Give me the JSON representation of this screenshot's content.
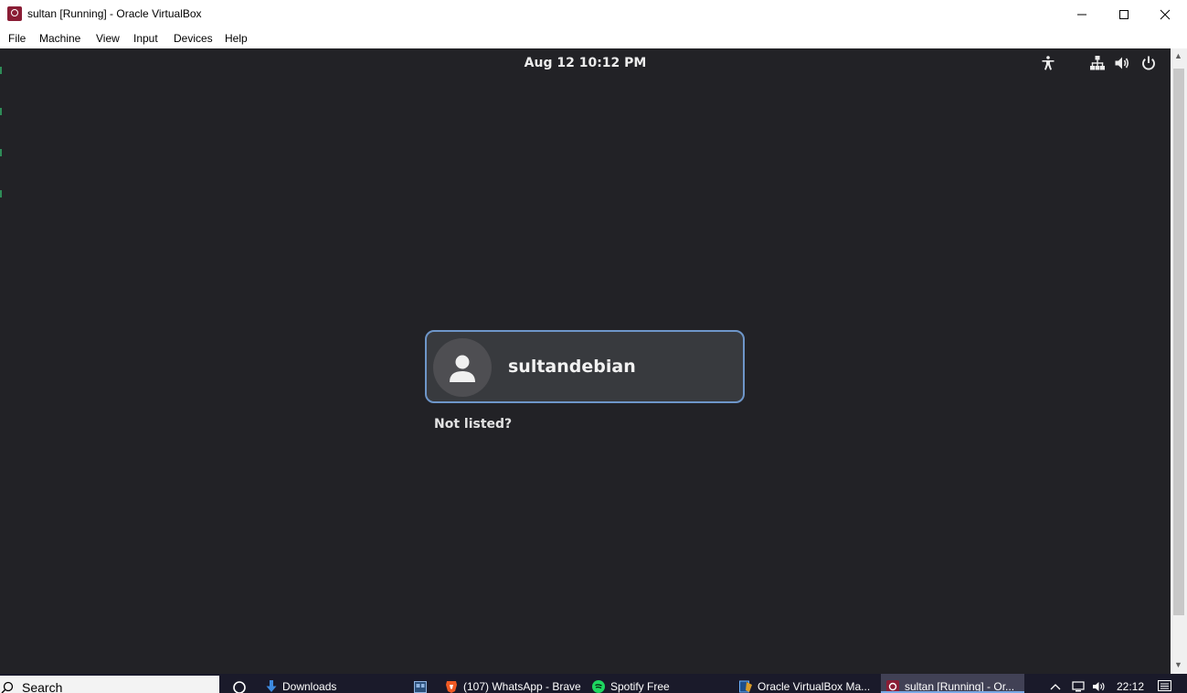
{
  "window": {
    "title": "sultan [Running] - Oracle VirtualBox",
    "controls": [
      "minimize-icon",
      "maximize-icon",
      "close-icon"
    ]
  },
  "menubar": {
    "items": [
      "File",
      "Machine",
      "View",
      "Input",
      "Devices",
      "Help"
    ]
  },
  "vm": {
    "topbar": {
      "clock": "Aug 12  10:12 PM",
      "icons": [
        "accessibility-icon",
        "network-icon",
        "volume-icon",
        "power-icon"
      ]
    },
    "login": {
      "username": "sultandebian",
      "not_listed": "Not listed?"
    }
  },
  "colors": {
    "vm_background": "#222226",
    "card_background": "#383a3e",
    "card_border": "#6e96c9",
    "taskbar": "#1a1a2a"
  },
  "taskbar": {
    "search_placeholder": "Search",
    "items": [
      {
        "label": "Downloads",
        "icon": "download-icon"
      },
      {
        "label": "",
        "icon": "image-app-icon"
      },
      {
        "label": "(107) WhatsApp - Brave",
        "icon": "brave-icon"
      },
      {
        "label": "Spotify Free",
        "icon": "spotify-icon"
      },
      {
        "label": "Oracle VirtualBox Ma...",
        "icon": "virtualbox-icon"
      },
      {
        "label": "sultan [Running] - Or...",
        "icon": "virtualbox-vm-icon"
      }
    ],
    "tray": {
      "time": "22:12",
      "icons": [
        "chevron-up-icon",
        "network-icon",
        "volume-icon",
        "notification-icon"
      ]
    }
  }
}
